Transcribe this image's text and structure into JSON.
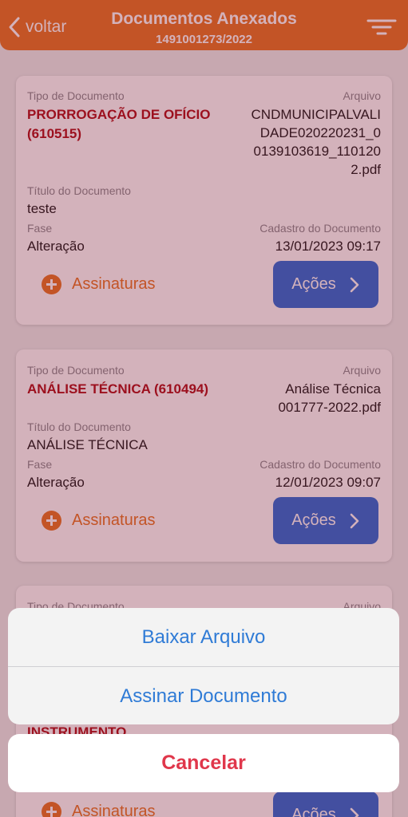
{
  "header": {
    "back_label": "voltar",
    "title": "Documentos Anexados",
    "subtitle": "1491001273/2022",
    "back_icon": "chevron-left-icon",
    "filter_icon": "filter-icon",
    "color": "#e8792a"
  },
  "labels": {
    "tipo": "Tipo de Documento",
    "arquivo": "Arquivo",
    "titulo": "Título do Documento",
    "fase": "Fase",
    "cadastro": "Cadastro do Documento",
    "assinaturas": "Assinaturas",
    "acoes": "Ações"
  },
  "documents": [
    {
      "type_line1": "PRORROGAÇÃO DE OFÍCIO",
      "type_line2": "(610515)",
      "file_lines": [
        "CNDMUNICIPALVALI",
        "DADE020220231_0",
        "0139103619_110120",
        "2.pdf"
      ],
      "title": "teste",
      "phase": "Alteração",
      "date": "13/01/2023 09:17"
    },
    {
      "type_line1": "ANÁLISE TÉCNICA (610494)",
      "file_lines": [
        "Análise Técnica",
        "001777-2022.pdf"
      ],
      "title": "ANÁLISE TÉCNICA",
      "phase": "Alteração",
      "date": "12/01/2023 09:07"
    },
    {
      "partial_type": "INSTRUMENTO"
    }
  ],
  "action_sheet": {
    "download": "Baixar Arquivo",
    "sign": "Assinar Documento",
    "cancel": "Cancelar",
    "accent": "#2f7bd6",
    "cancel_color": "#e0374b"
  },
  "colors": {
    "doc_type": "#b1171f",
    "button": "#3271d8"
  }
}
